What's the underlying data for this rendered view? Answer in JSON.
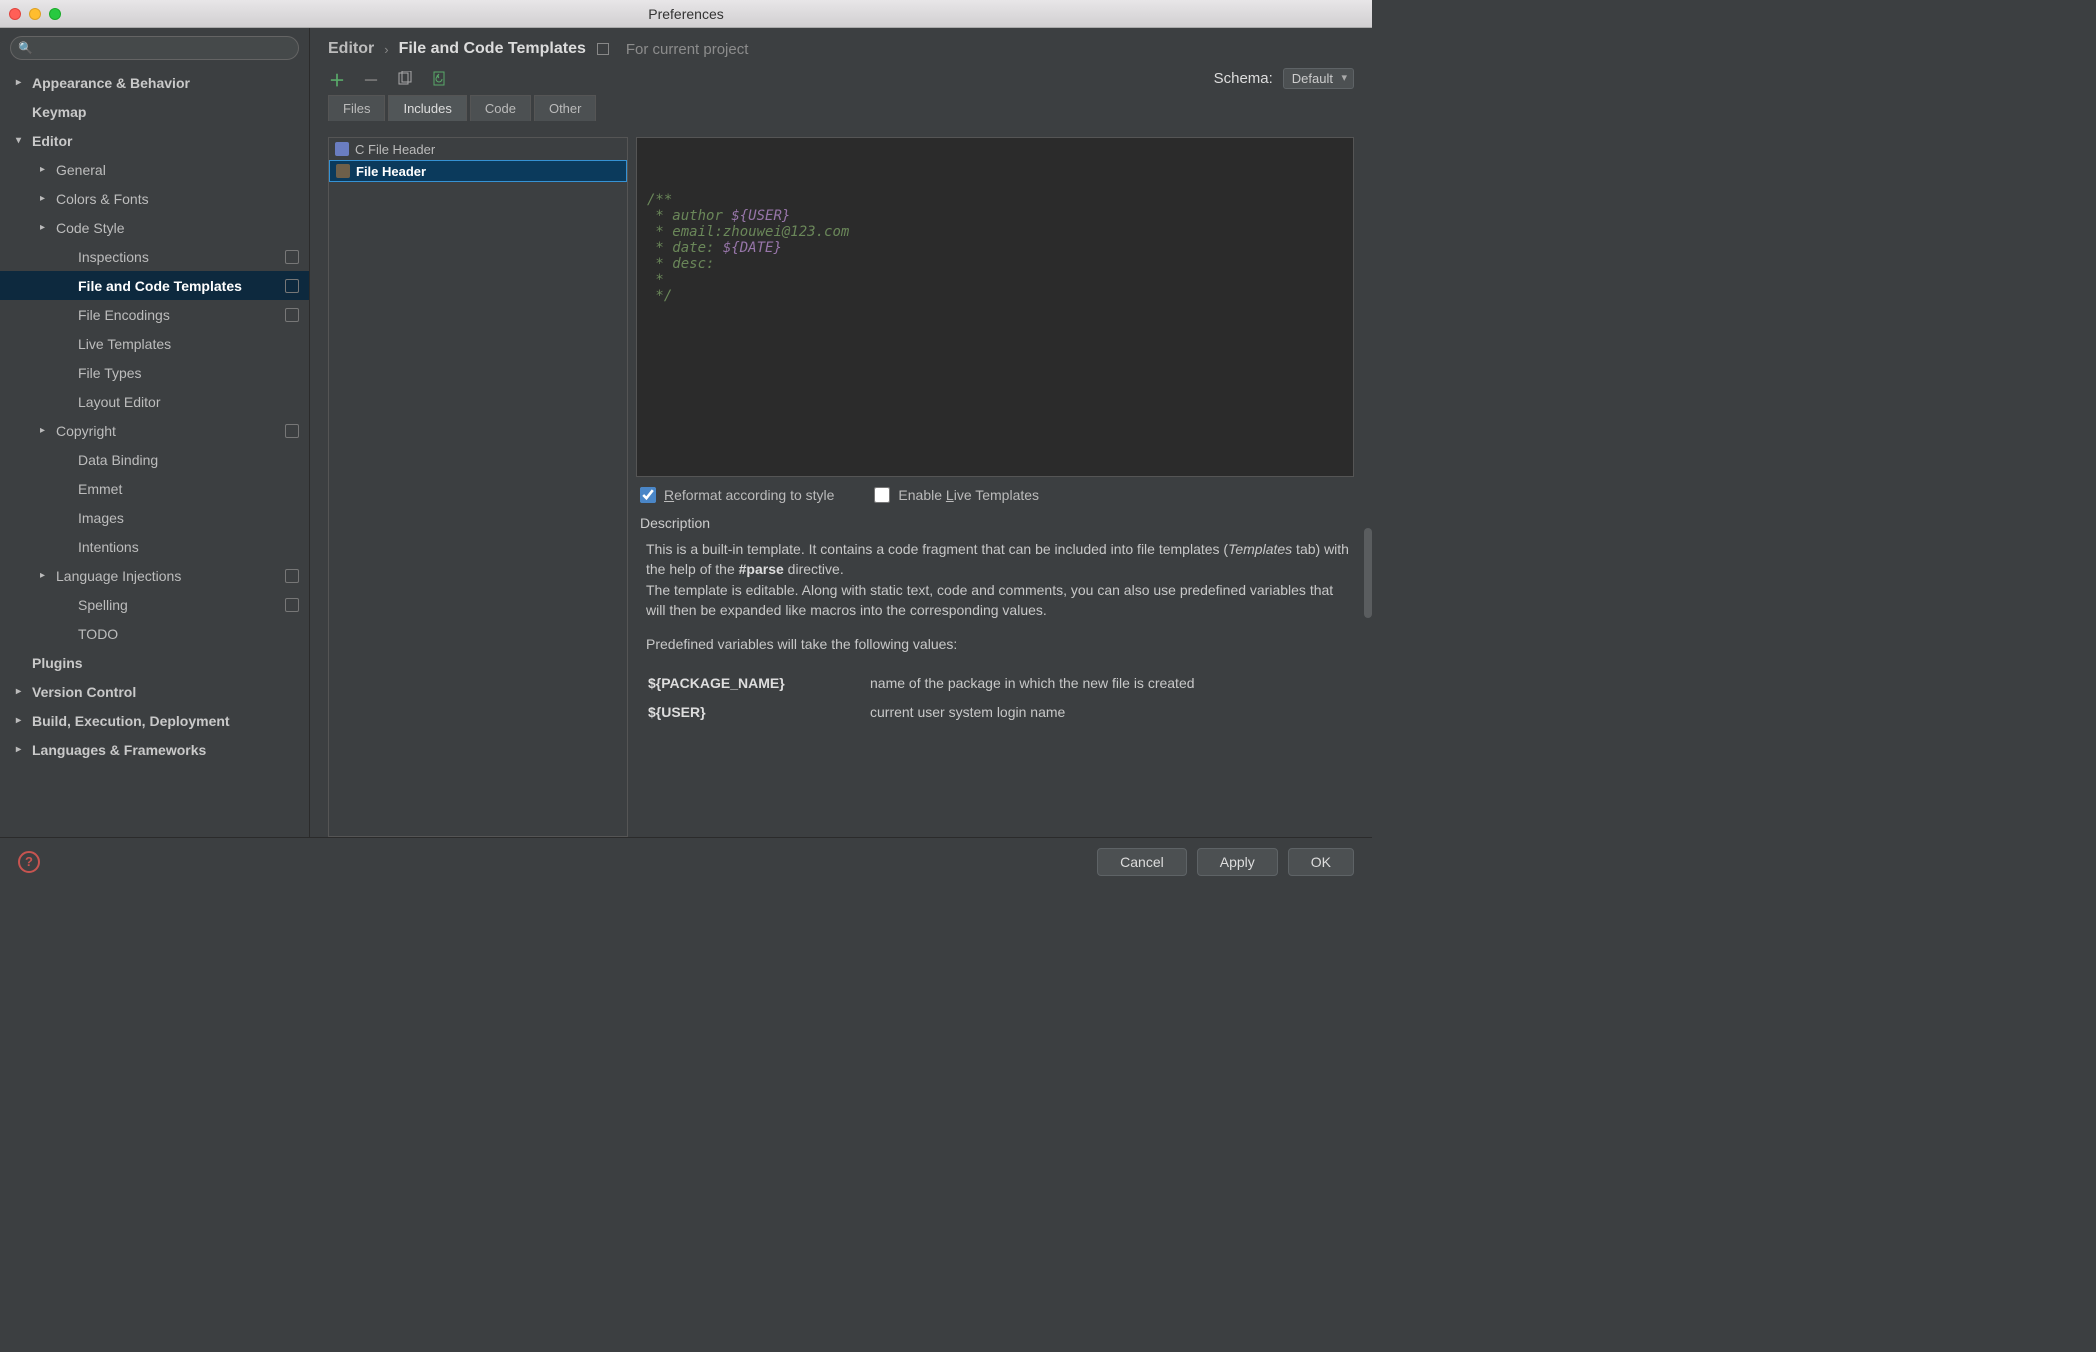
{
  "window": {
    "title": "Preferences"
  },
  "search": {
    "placeholder": ""
  },
  "sidebar": {
    "items": [
      {
        "label": "Appearance & Behavior",
        "level": 0,
        "arrow": "▸"
      },
      {
        "label": "Keymap",
        "level": 0,
        "arrow": ""
      },
      {
        "label": "Editor",
        "level": 0,
        "arrow": "▾"
      },
      {
        "label": "General",
        "level": 1,
        "arrow": "▸"
      },
      {
        "label": "Colors & Fonts",
        "level": 1,
        "arrow": "▸"
      },
      {
        "label": "Code Style",
        "level": 1,
        "arrow": "▸"
      },
      {
        "label": "Inspections",
        "level": 2,
        "arrow": "",
        "badge": true
      },
      {
        "label": "File and Code Templates",
        "level": 2,
        "arrow": "",
        "badge": true,
        "selected": true
      },
      {
        "label": "File Encodings",
        "level": 2,
        "arrow": "",
        "badge": true
      },
      {
        "label": "Live Templates",
        "level": 2,
        "arrow": ""
      },
      {
        "label": "File Types",
        "level": 2,
        "arrow": ""
      },
      {
        "label": "Layout Editor",
        "level": 2,
        "arrow": ""
      },
      {
        "label": "Copyright",
        "level": 1,
        "arrow": "▸",
        "badge": true
      },
      {
        "label": "Data Binding",
        "level": 2,
        "arrow": ""
      },
      {
        "label": "Emmet",
        "level": 2,
        "arrow": ""
      },
      {
        "label": "Images",
        "level": 2,
        "arrow": ""
      },
      {
        "label": "Intentions",
        "level": 2,
        "arrow": ""
      },
      {
        "label": "Language Injections",
        "level": 1,
        "arrow": "▸",
        "badge": true
      },
      {
        "label": "Spelling",
        "level": 2,
        "arrow": "",
        "badge": true
      },
      {
        "label": "TODO",
        "level": 2,
        "arrow": ""
      },
      {
        "label": "Plugins",
        "level": 0,
        "arrow": ""
      },
      {
        "label": "Version Control",
        "level": 0,
        "arrow": "▸"
      },
      {
        "label": "Build, Execution, Deployment",
        "level": 0,
        "arrow": "▸"
      },
      {
        "label": "Languages & Frameworks",
        "level": 0,
        "arrow": "▸"
      }
    ]
  },
  "breadcrumb": {
    "root": "Editor",
    "leaf": "File and Code Templates",
    "hint": "For current project"
  },
  "schema": {
    "label": "Schema:",
    "value": "Default"
  },
  "tabs": [
    "Files",
    "Includes",
    "Code",
    "Other"
  ],
  "active_tab": 1,
  "template_list": [
    {
      "label": "C File Header",
      "icon": "c"
    },
    {
      "label": "File Header",
      "icon": "j",
      "selected": true
    }
  ],
  "editor_lines": [
    {
      "parts": [
        {
          "t": "/**",
          "c": "cm-green"
        }
      ]
    },
    {
      "parts": [
        {
          "t": " * ",
          "c": "cm-green"
        },
        {
          "t": "author ",
          "c": "cm-green"
        },
        {
          "t": "${USER}",
          "c": "cm-var"
        }
      ]
    },
    {
      "parts": [
        {
          "t": " * ",
          "c": "cm-green"
        },
        {
          "t": "email:zhouwei@123.com",
          "c": "cm-green"
        }
      ]
    },
    {
      "parts": [
        {
          "t": " * ",
          "c": "cm-green"
        },
        {
          "t": "date: ",
          "c": "cm-green"
        },
        {
          "t": "${DATE}",
          "c": "cm-var"
        }
      ]
    },
    {
      "parts": [
        {
          "t": " * ",
          "c": "cm-green"
        },
        {
          "t": "desc:",
          "c": "cm-green"
        }
      ]
    },
    {
      "parts": [
        {
          "t": " *",
          "c": "cm-green"
        }
      ]
    },
    {
      "parts": [
        {
          "t": " */",
          "c": "cm-green"
        }
      ]
    }
  ],
  "checks": {
    "reformat_pre": "R",
    "reformat_label": "eformat according to style",
    "reformat_checked": true,
    "enable_pre": "Enable ",
    "enable_mn": "L",
    "enable_post": "ive Templates",
    "enable_checked": false
  },
  "desc": {
    "heading": "Description",
    "p1_a": "This is a built-in template. It contains a code fragment that can be included into file templates (",
    "p1_em": "Templates",
    "p1_b": " tab) with the help of the ",
    "p1_strong": "#parse",
    "p1_c": " directive.",
    "p2": "The template is editable. Along with static text, code and comments, you can also use predefined variables that will then be expanded like macros into the corresponding values.",
    "p3": "Predefined variables will take the following values:",
    "vars": [
      {
        "name": "${PACKAGE_NAME}",
        "desc": "name of the package in which the new file is created"
      },
      {
        "name": "${USER}",
        "desc": "current user system login name"
      }
    ]
  },
  "footer": {
    "cancel": "Cancel",
    "apply": "Apply",
    "ok": "OK"
  }
}
